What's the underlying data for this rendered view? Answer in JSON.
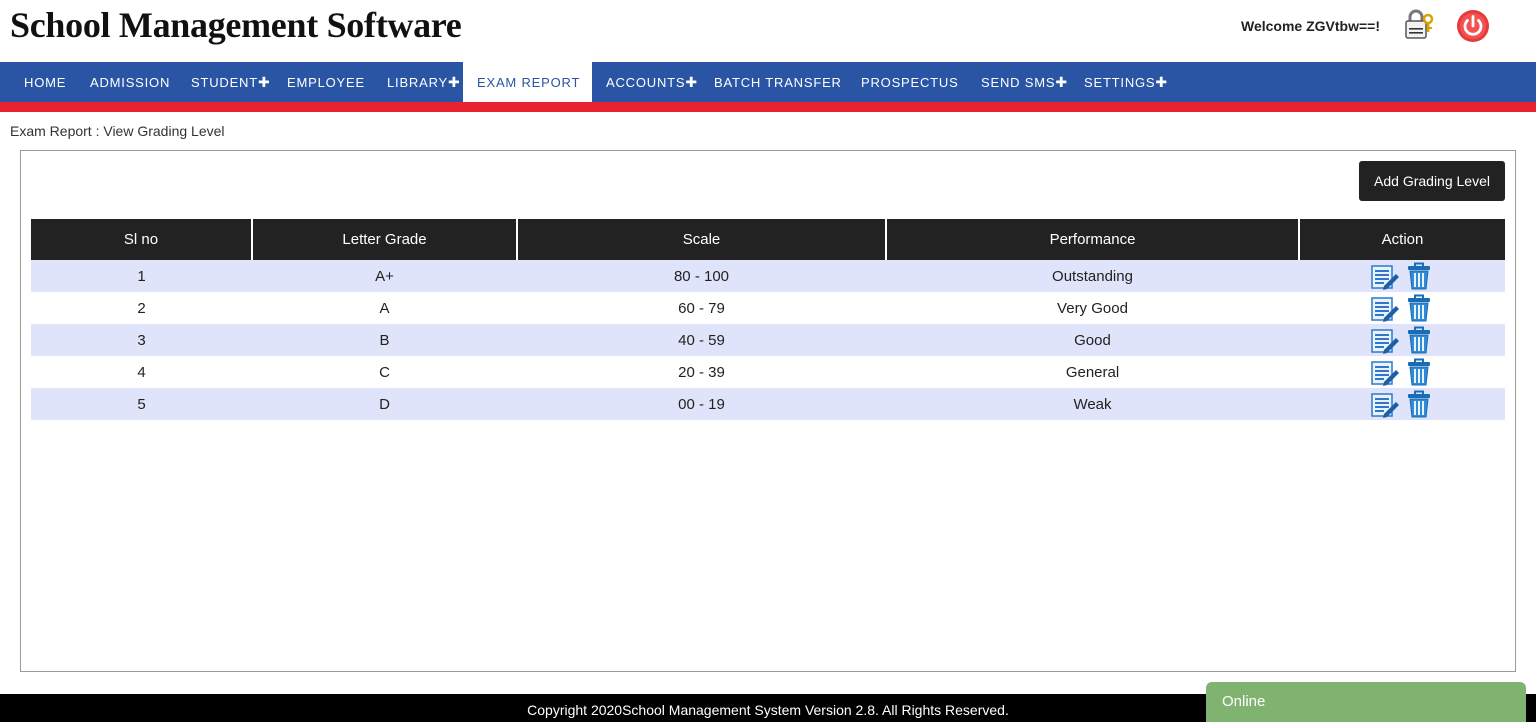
{
  "header": {
    "title": "School Management Software",
    "welcome": "Welcome ZGVtbw==!"
  },
  "nav": {
    "items": [
      {
        "label": "HOME",
        "plus": ""
      },
      {
        "label": "ADMISSION",
        "plus": ""
      },
      {
        "label": "STUDENT",
        "plus": "✚"
      },
      {
        "label": "EMPLOYEE",
        "plus": ""
      },
      {
        "label": "LIBRARY",
        "plus": "✚"
      },
      {
        "label": "EXAM REPORT",
        "plus": ""
      },
      {
        "label": "ACCOUNTS",
        "plus": "✚"
      },
      {
        "label": "BATCH TRANSFER",
        "plus": ""
      },
      {
        "label": "PROSPECTUS",
        "plus": ""
      },
      {
        "label": "SEND SMS",
        "plus": "✚"
      },
      {
        "label": "SETTINGS",
        "plus": "✚"
      }
    ],
    "active": "EXAM REPORT",
    "colors": {
      "bar": "#2a55a5",
      "stripe": "#e8232f"
    }
  },
  "breadcrumb": "Exam Report : View Grading Level",
  "toolbar": {
    "add_label": "Add Grading Level"
  },
  "table": {
    "headers": [
      "Sl no",
      "Letter Grade",
      "Scale",
      "Performance",
      "Action"
    ],
    "rows": [
      {
        "sl": "1",
        "grade": "A+",
        "scale": "80 - 100",
        "performance": "Outstanding"
      },
      {
        "sl": "2",
        "grade": "A",
        "scale": "60 - 79",
        "performance": "Very Good"
      },
      {
        "sl": "3",
        "grade": "B",
        "scale": "40 - 59",
        "performance": "Good"
      },
      {
        "sl": "4",
        "grade": "C",
        "scale": "20 - 39",
        "performance": "General"
      },
      {
        "sl": "5",
        "grade": "D",
        "scale": "00 - 19",
        "performance": "Weak"
      }
    ],
    "row_icons": [
      "edit-icon",
      "delete-icon"
    ]
  },
  "footer": {
    "copyright": "Copyright 2020School Management System Version 2.8. All Rights Reserved."
  },
  "chat": {
    "status": "Online"
  }
}
